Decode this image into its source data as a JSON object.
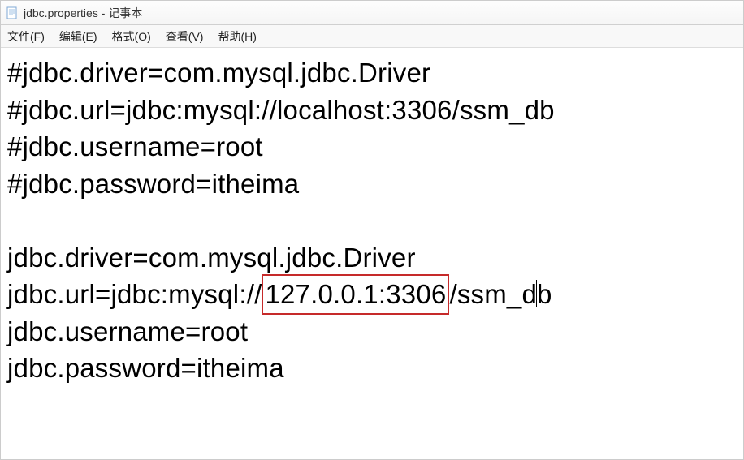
{
  "titlebar": {
    "title": "jdbc.properties - 记事本"
  },
  "menubar": {
    "items": [
      {
        "label": "文件(F)"
      },
      {
        "label": "编辑(E)"
      },
      {
        "label": "格式(O)"
      },
      {
        "label": "查看(V)"
      },
      {
        "label": "帮助(H)"
      }
    ]
  },
  "document": {
    "lines": [
      "#jdbc.driver=com.mysql.jdbc.Driver",
      "#jdbc.url=jdbc:mysql://localhost:3306/ssm_db",
      "#jdbc.username=root",
      "#jdbc.password=itheima",
      "",
      "jdbc.driver=com.mysql.jdbc.Driver"
    ],
    "url_line_prefix": "jdbc.url=jdbc:mysql://",
    "url_line_highlight": "127.0.0.1:3306",
    "url_line_suffix_before_caret": "/ssm_d",
    "url_line_suffix_after_caret": "b",
    "trailing_lines": [
      "jdbc.username=root",
      "jdbc.password=itheima"
    ]
  }
}
